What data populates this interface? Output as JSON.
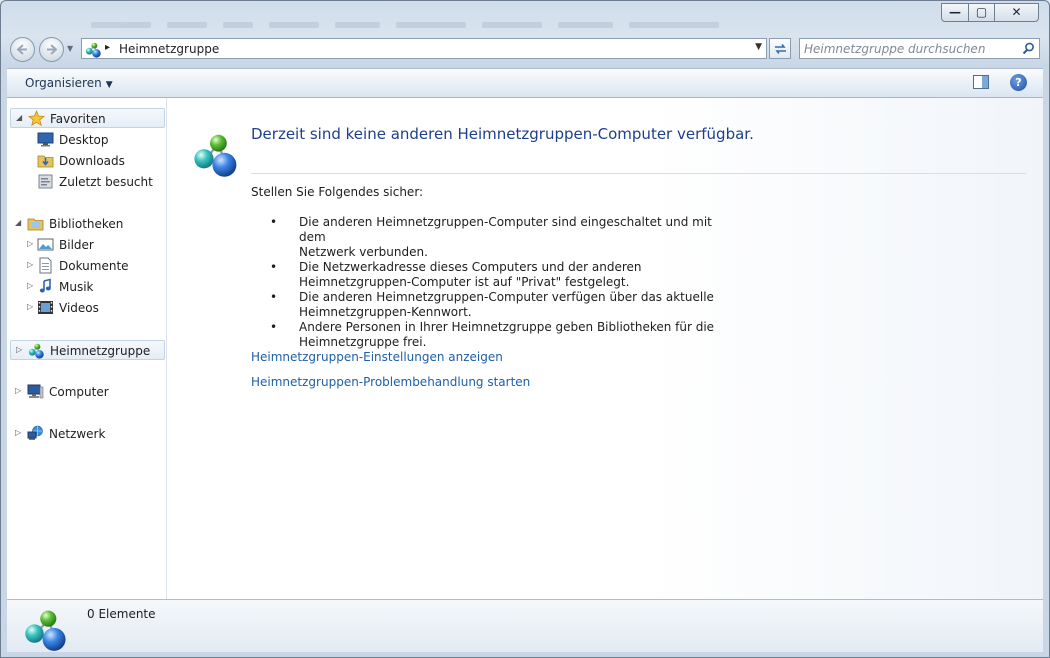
{
  "window": {
    "minimize_glyph": "—",
    "maximize_glyph": "▢",
    "close_glyph": "✕"
  },
  "address": {
    "path": "Heimnetzgruppe",
    "sep": "▸",
    "dropdown": "▼"
  },
  "search": {
    "placeholder": "Heimnetzgruppe durchsuchen"
  },
  "toolbar": {
    "organize": "Organisieren",
    "organize_arrow": "▼",
    "help": "?"
  },
  "icons": [
    "star-icon",
    "desktop-icon",
    "downloads-folder-icon",
    "recent-places-icon",
    "libraries-icon",
    "pictures-icon",
    "documents-icon",
    "music-icon",
    "videos-icon",
    "homegroup-icon",
    "computer-icon",
    "network-icon",
    "search-icon",
    "refresh-icon",
    "preview-pane-icon",
    "help-icon"
  ],
  "nav": {
    "favorites": {
      "label": "Favoriten",
      "items": [
        "Desktop",
        "Downloads",
        "Zuletzt besucht"
      ]
    },
    "libraries": {
      "label": "Bibliotheken",
      "items": [
        "Bilder",
        "Dokumente",
        "Musik",
        "Videos"
      ]
    },
    "homegroup": {
      "label": "Heimnetzgruppe"
    },
    "computer": {
      "label": "Computer"
    },
    "network": {
      "label": "Netzwerk"
    },
    "expanded_glyph": "◢",
    "collapsed_glyph": "▷"
  },
  "content": {
    "heading": "Derzeit sind keine anderen Heimnetzgruppen-Computer verfügbar.",
    "ensure": "Stellen Sie Folgendes sicher:",
    "bullets": [
      [
        "Die anderen Heimnetzgruppen-Computer sind eingeschaltet und mit dem",
        "Netzwerk verbunden."
      ],
      [
        "Die Netzwerkadresse dieses Computers und der anderen",
        "Heimnetzgruppen-Computer ist auf \"Privat\" festgelegt."
      ],
      [
        "Die anderen Heimnetzgruppen-Computer verfügen über das aktuelle",
        "Heimnetzgruppen-Kennwort."
      ],
      [
        "Andere Personen in Ihrer Heimnetzgruppe geben Bibliotheken für die",
        "Heimnetzgruppe frei."
      ]
    ],
    "link_settings": "Heimnetzgruppen-Einstellungen anzeigen",
    "link_troubleshoot": "Heimnetzgruppen-Problembehandlung starten"
  },
  "status": {
    "count": "0 Elemente"
  }
}
